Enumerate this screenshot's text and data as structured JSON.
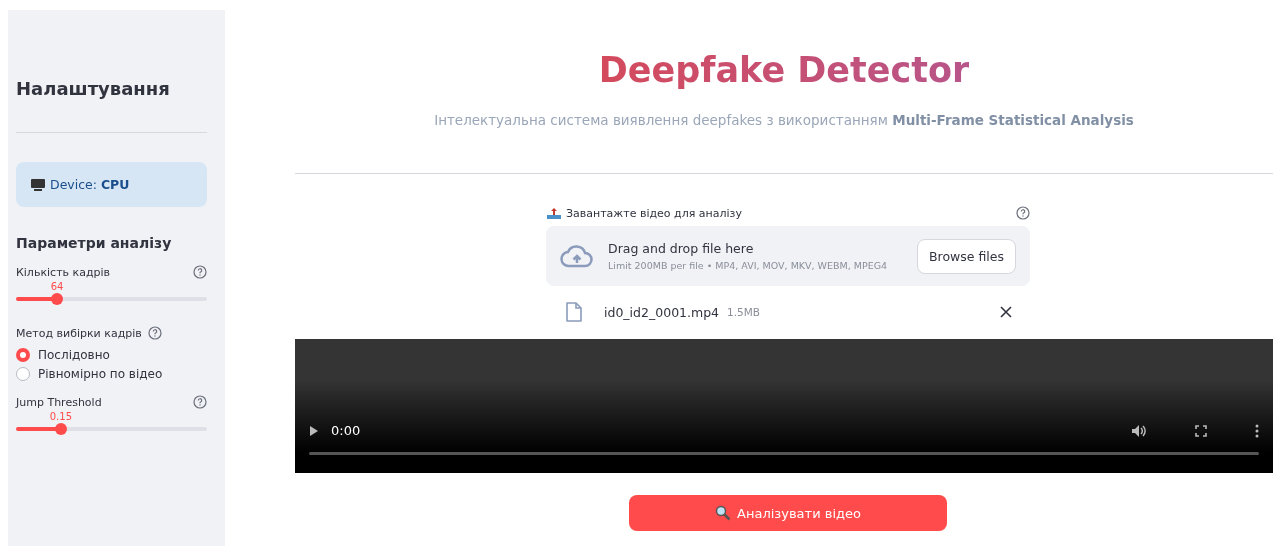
{
  "sidebar": {
    "title": "Налаштування",
    "device": "Device: **CPU**",
    "section_title": "Параметри аналізу",
    "controls": [
      {
        "kind": "slider",
        "label": "Кількість кадрів",
        "reading": "64",
        "level": 0.215
      },
      {
        "kind": "radio",
        "label": "Метод вибірки кадрів",
        "options": [
          {
            "label": "Послідовно",
            "selected": true
          },
          {
            "label": "Рівномірно по відео",
            "selected": false
          }
        ]
      },
      {
        "kind": "slider",
        "label": "Jump Threshold",
        "reading": "0.15",
        "level": 0.235
      }
    ]
  },
  "main": {
    "title": "Deepfake Detector",
    "subtitle": "Інтелектуальна система виявлення deepfakes з використанням **Multi-Frame Statistical Analysis**",
    "uploader": {
      "label": "Завантажте відео для аналізу",
      "drop_text": "Drag and drop file here",
      "limit_text": "Limit 200MB per file • MP4, AVI, MOV, MKV, WEBM, MPEG4",
      "browse_button": "Browse files",
      "file": {
        "name": "id0_id2_0001.mp4",
        "size": "1.5MB"
      }
    },
    "video": {
      "time": "0:00"
    },
    "analyze_button": "Аналізувати відео"
  }
}
